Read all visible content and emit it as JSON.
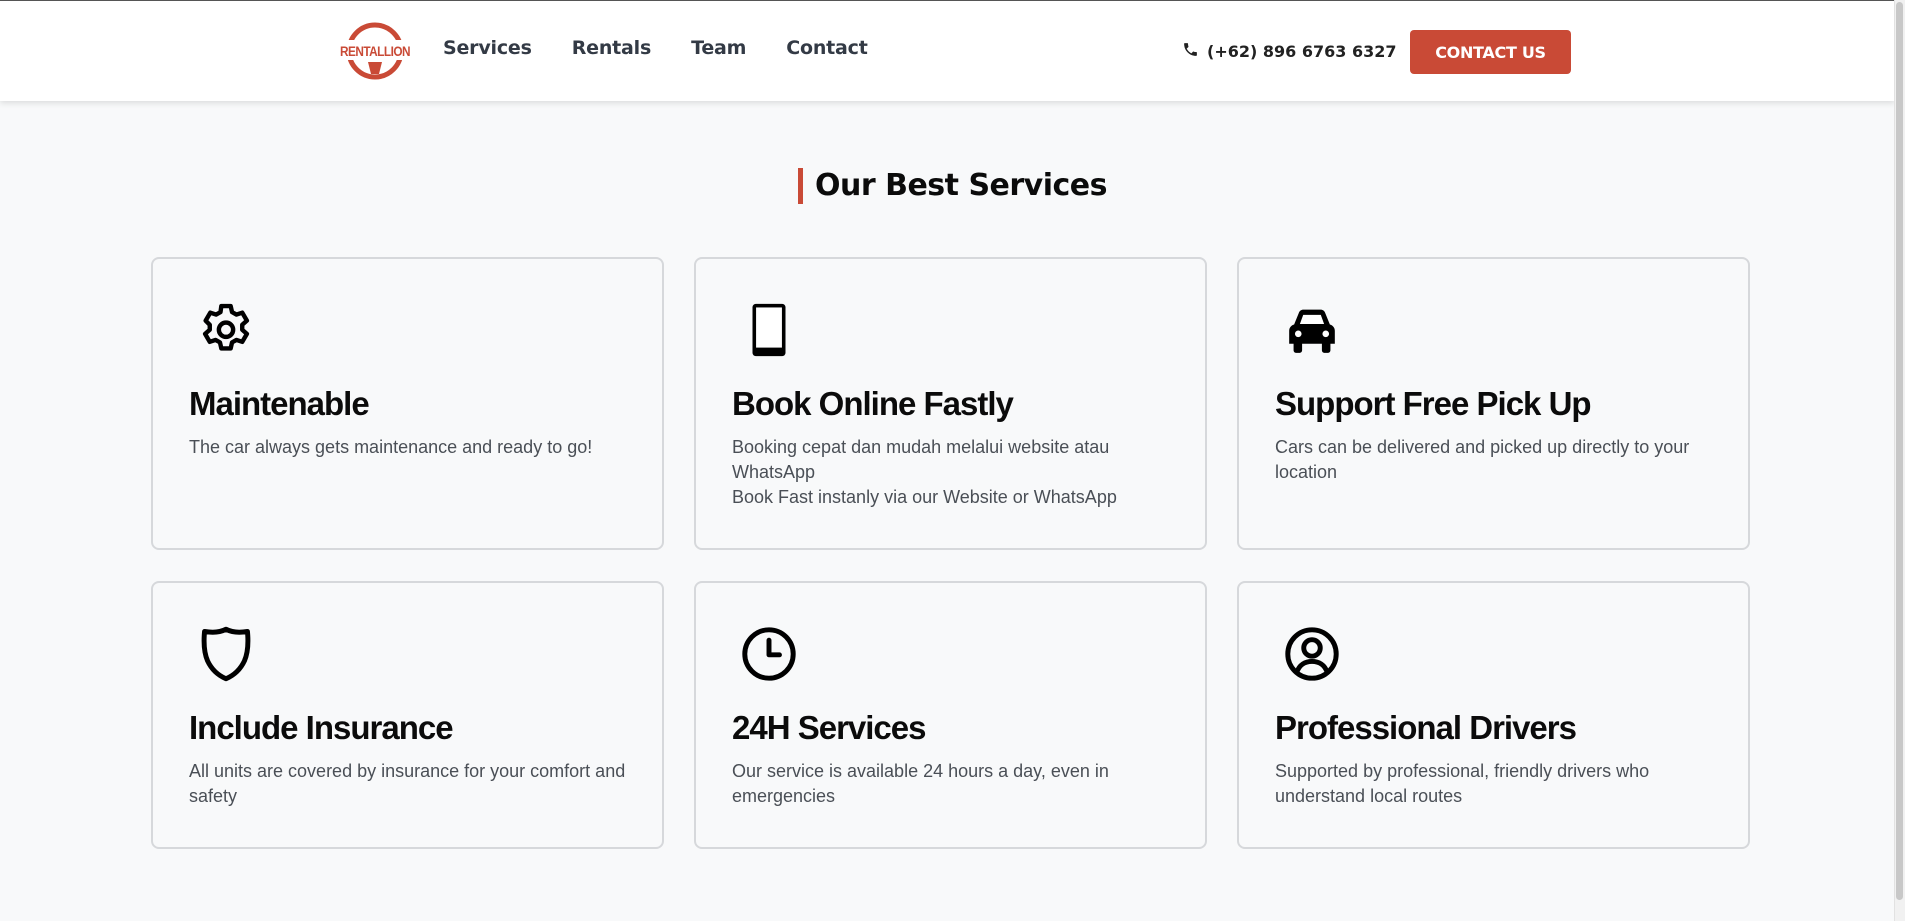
{
  "header": {
    "logo_text": "RENTALLION",
    "nav": [
      "Services",
      "Rentals",
      "Team",
      "Contact"
    ],
    "phone": "(+62) 896 6763 6327",
    "cta": "CONTACT US"
  },
  "section": {
    "title": "Our Best Services"
  },
  "services": [
    {
      "icon": "gear-icon",
      "title": "Maintenable",
      "desc": [
        "The car always gets maintenance and ready to go!"
      ]
    },
    {
      "icon": "tablet-icon",
      "title": "Book Online Fastly",
      "desc": [
        "Booking cepat dan mudah melalui website atau WhatsApp",
        "Book Fast instanly via our Website or WhatsApp"
      ]
    },
    {
      "icon": "car-icon",
      "title": "Support Free Pick Up",
      "desc": [
        "Cars can be delivered and picked up directly to your location"
      ]
    },
    {
      "icon": "shield-icon",
      "title": "Include Insurance",
      "desc": [
        "All units are covered by insurance for your comfort and safety"
      ]
    },
    {
      "icon": "clock-icon",
      "title": "24H Services",
      "desc": [
        "Our service is available 24 hours a day, even in emergencies"
      ]
    },
    {
      "icon": "user-circle-icon",
      "title": "Professional Drivers",
      "desc": [
        "Supported by professional, friendly drivers who understand local routes"
      ]
    }
  ],
  "colors": {
    "accent": "#c94a36",
    "text": "#0b0b0b",
    "muted": "#4a4f56",
    "background": "#f8f9fa"
  }
}
